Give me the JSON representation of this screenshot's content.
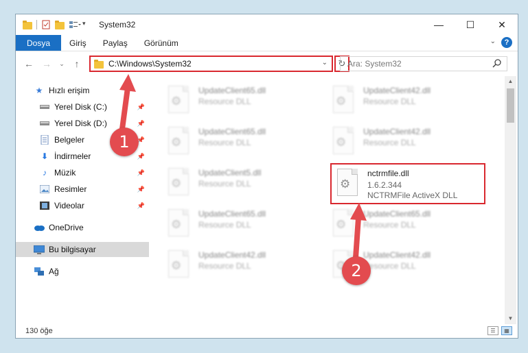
{
  "window": {
    "title": "System32",
    "controls": {
      "minimize": "—",
      "maximize": "☐",
      "close": "✕"
    }
  },
  "ribbon": {
    "tabs": [
      {
        "label": "Dosya",
        "active": true
      },
      {
        "label": "Giriş"
      },
      {
        "label": "Paylaş"
      },
      {
        "label": "Görünüm"
      }
    ],
    "help": "?"
  },
  "nav": {
    "address": "C:\\Windows\\System32",
    "search_placeholder": "Ara: System32"
  },
  "sidebar": {
    "items": [
      {
        "label": "Hızlı erişim",
        "icon": "star-icon"
      },
      {
        "label": "Yerel Disk (C:)",
        "icon": "drive-icon",
        "pinned": true
      },
      {
        "label": "Yerel Disk (D:)",
        "icon": "drive-icon",
        "pinned": true
      },
      {
        "label": "Belgeler",
        "icon": "documents-icon",
        "pinned": true
      },
      {
        "label": "İndirmeler",
        "icon": "download-icon",
        "pinned": true
      },
      {
        "label": "Müzik",
        "icon": "music-icon",
        "pinned": true
      },
      {
        "label": "Resimler",
        "icon": "pictures-icon",
        "pinned": true
      },
      {
        "label": "Videolar",
        "icon": "video-icon",
        "pinned": true
      },
      {
        "label": "OneDrive",
        "icon": "cloud-icon"
      },
      {
        "label": "Bu bilgisayar",
        "icon": "computer-icon",
        "selected": true
      },
      {
        "label": "Ağ",
        "icon": "network-icon"
      }
    ]
  },
  "files": [
    {
      "name": "UpdateClient65.dll",
      "desc": "Resource DLL",
      "blurred": true
    },
    {
      "name": "UpdateClient42.dll",
      "desc": "Resource DLL",
      "blurred": true
    },
    {
      "name": "UpdateClient65.dll",
      "desc": "Resource DLL",
      "blurred": true
    },
    {
      "name": "UpdateClient42.dll",
      "desc": "Resource DLL",
      "blurred": true
    },
    {
      "name": "UpdateClient5.dll",
      "desc": "Resource DLL",
      "blurred": true
    },
    {
      "name": "nctrmfile.dll",
      "version": "1.6.2.344",
      "desc": "NCTRMFile ActiveX DLL",
      "blurred": false
    },
    {
      "name": "UpdateClient65.dll",
      "desc": "Resource DLL",
      "blurred": true
    },
    {
      "name": "UpdateClient65.dll",
      "desc": "Resource DLL",
      "blurred": true
    },
    {
      "name": "UpdateClient42.dll",
      "desc": "Resource DLL",
      "blurred": true
    },
    {
      "name": "UpdateClient42.dll",
      "desc": "Resource DLL",
      "blurred": true
    }
  ],
  "status": {
    "count": "130 öğe"
  },
  "callouts": [
    {
      "label": "1"
    },
    {
      "label": "2"
    }
  ],
  "colors": {
    "accent": "#1a6fc4",
    "highlight": "#d9272e",
    "badge": "#e34b4f"
  }
}
